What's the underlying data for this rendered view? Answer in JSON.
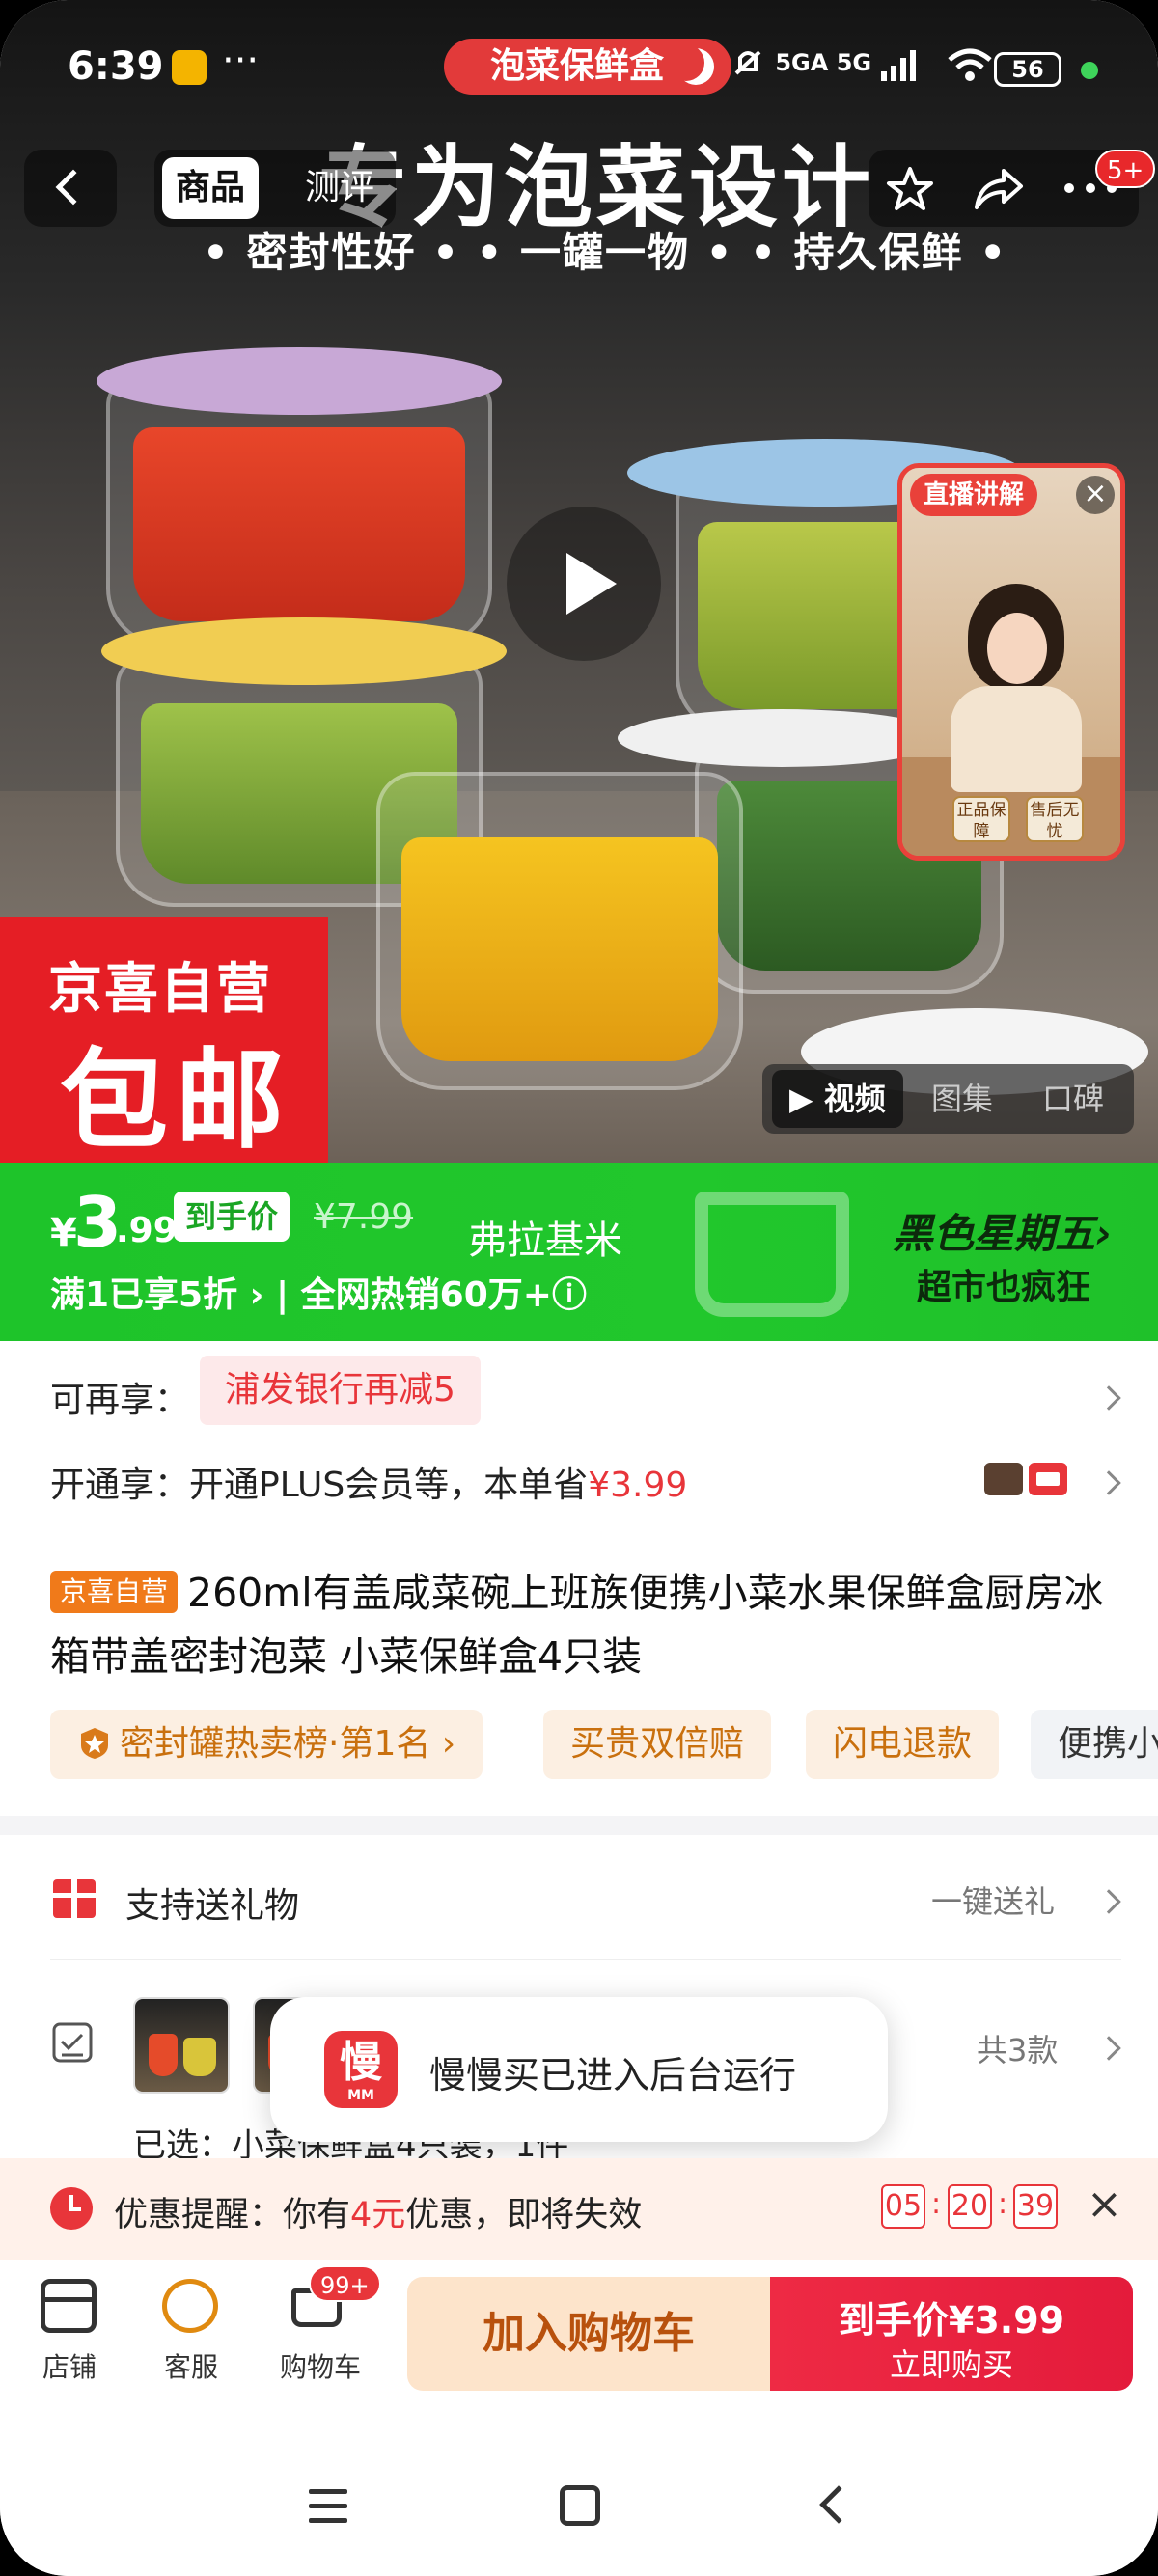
{
  "status_bar": {
    "time": "6:39",
    "more": "···",
    "app_pill": "泡菜保鲜盒",
    "signal": "5GA 5G",
    "battery": "56"
  },
  "nav": {
    "tab_product": "商品",
    "tab_reviews": "测评",
    "badge": "5+"
  },
  "hero": {
    "headline": "专为泡菜设计",
    "subline": "• 密封性好 • • 一罐一物 • • 持久保鲜 •",
    "badge_line1": "京喜自营",
    "badge_line2": "包邮",
    "live_tag": "直播讲解",
    "live_chip1": "正品保障",
    "live_chip2": "售后无忧",
    "media_tabs": [
      "视频",
      "图集",
      "口碑"
    ]
  },
  "price_band": {
    "currency": "¥",
    "price_int": "3",
    "price_dec": ".99",
    "tag": "到手价",
    "original": "¥7.99",
    "watermark": "弗拉基米",
    "promo": "满1已享5折 › | 全网热销60万+ⓘ",
    "event_title": "黑色星期五›",
    "event_sub": "超市也疯狂"
  },
  "offers": {
    "row1_label": "可再享：",
    "row1_pill": "浦发银行再减5",
    "row2_label": "开通享：开通PLUS会员等，本单省",
    "row2_amount": "¥3.99"
  },
  "product": {
    "store_tag": "京喜自营",
    "title": "260ml有盖咸菜碗上班族便携小菜水果保鲜盒厨房冰箱带盖密封泡菜 小菜保鲜盒4只装",
    "chips": [
      "密封罐热卖榜·第1名 ›",
      "买贵双倍赔",
      "闪电退款",
      "便携小"
    ]
  },
  "gift": {
    "label": "支持送礼物",
    "action": "一键送礼"
  },
  "variant": {
    "count": "共3款",
    "selected": "已选：小菜保鲜盒4只装，1件"
  },
  "toast": {
    "icon_char": "慢",
    "icon_sub": "MM",
    "text": "慢慢买已进入后台运行"
  },
  "reminder": {
    "prefix": "优惠提醒：你有",
    "amount": "4元",
    "suffix": "优惠，即将失效",
    "hh": "05",
    "mm": "20",
    "ss": "39"
  },
  "bottom": {
    "store": "店铺",
    "service": "客服",
    "cart": "购物车",
    "cart_badge": "99+",
    "add_cart": "加入购物车",
    "buy_line1": "到手价¥3.99",
    "buy_line2": "立即购买"
  }
}
